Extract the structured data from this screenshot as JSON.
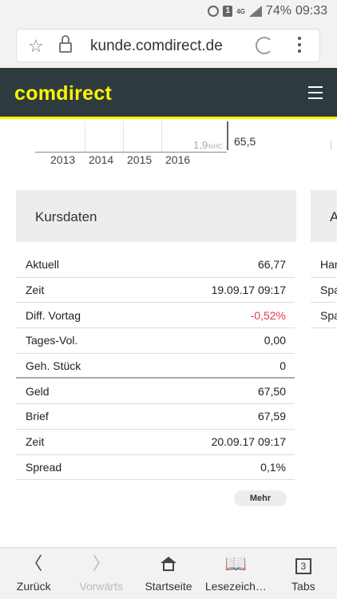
{
  "status": {
    "network": "4G",
    "sim": "1",
    "battery": "74%",
    "time": "09:33"
  },
  "browser": {
    "url": "kunde.comdirect.de"
  },
  "site": {
    "logo": "comdirect"
  },
  "chart": {
    "years": [
      "2013",
      "2014",
      "2015",
      "2016"
    ],
    "cursor_label": "1,9",
    "cursor_label_suffix": "%HC",
    "cursor_value": "65,5"
  },
  "kursdaten": {
    "title": "Kursdaten",
    "rows": [
      {
        "label": "Aktuell",
        "value": "66,77"
      },
      {
        "label": "Zeit",
        "value": "19.09.17 09:17"
      },
      {
        "label": "Diff. Vortag",
        "value": "-0,52%"
      },
      {
        "label": "Tages-Vol.",
        "value": "0,00"
      },
      {
        "label": "Geh. Stück",
        "value": "0"
      },
      {
        "label": "Geld",
        "value": "67,50"
      },
      {
        "label": "Brief",
        "value": "67,59"
      },
      {
        "label": "Zeit",
        "value": "20.09.17 09:17"
      },
      {
        "label": "Spread",
        "value": "0,1%"
      }
    ],
    "more_label": "Mehr"
  },
  "peek_card": {
    "title": "A",
    "rows": [
      "Har",
      "Spa",
      "Spa"
    ]
  },
  "bottom_nav": {
    "back": "Zurück",
    "forward": "Vorwärts",
    "home": "Startseite",
    "bookmarks": "Lesezeich…",
    "tabs": "Tabs",
    "tab_count": "3"
  },
  "colors": {
    "header_bg": "#2d3b3f",
    "brand_yellow": "#fff500",
    "negative": "#e63946"
  }
}
